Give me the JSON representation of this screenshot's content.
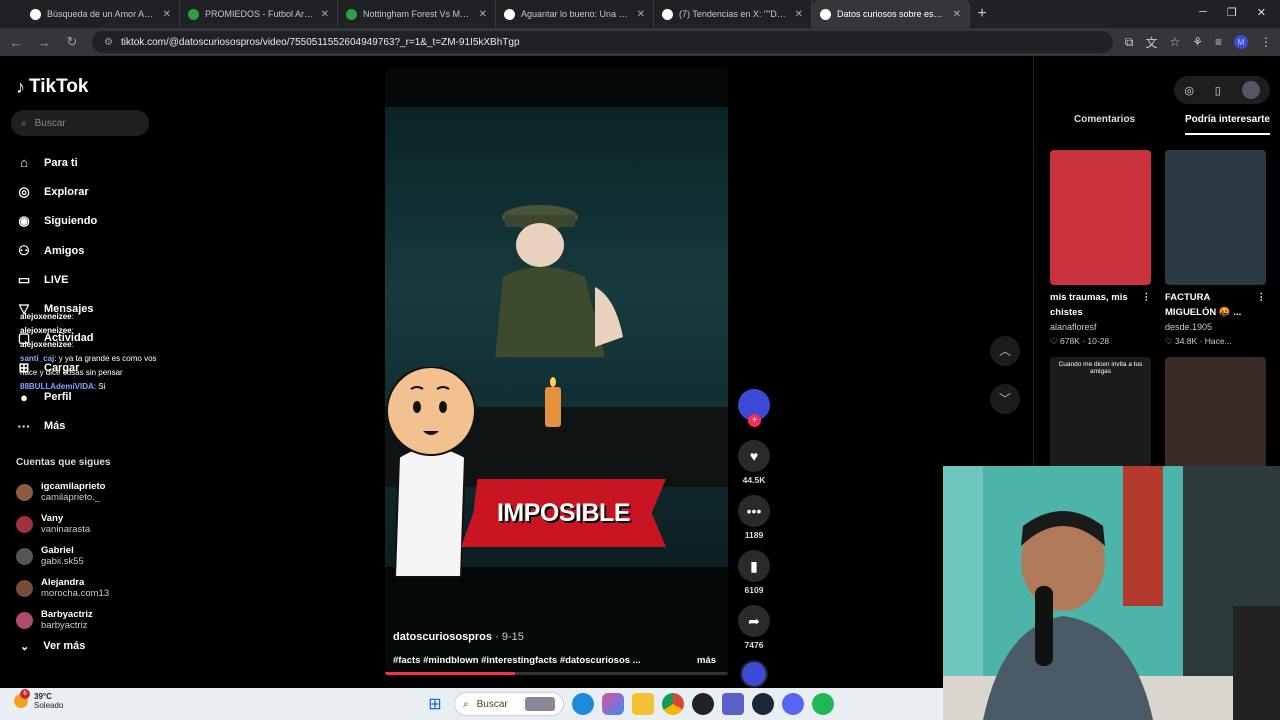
{
  "browser": {
    "tabs": [
      {
        "title": "Búsqueda de un Amor Apasionado",
        "color": "#ffffff"
      },
      {
        "title": "PROMIEDOS - Futbol Argentino",
        "color": "#2ea043"
      },
      {
        "title": "Nottingham Forest Vs Malmö FF",
        "color": "#2ea043"
      },
      {
        "title": "Aguantar lo bueno: Una experiencia",
        "color": "#ffffff"
      },
      {
        "title": "(7) Tendencias en X: \"\"Duka\": Pe",
        "color": "#ffffff"
      },
      {
        "title": "Datos curiosos sobre españoles",
        "color": "#ffffff",
        "active": true
      }
    ],
    "url": "tiktok.com/@datoscuriosospros/video/7550511552604949763?_r=1&_t=ZM-91I5kXBhTgp",
    "profile_initial": "M"
  },
  "sidebar": {
    "logo": "TikTok",
    "search_placeholder": "Buscar",
    "menu": [
      {
        "label": "Para ti",
        "icon": "home-icon",
        "glyph": "⌂"
      },
      {
        "label": "Explorar",
        "icon": "compass-icon",
        "glyph": "◎"
      },
      {
        "label": "Siguiendo",
        "icon": "following-icon",
        "glyph": "◉"
      },
      {
        "label": "Amigos",
        "icon": "friends-icon",
        "glyph": "⚇"
      },
      {
        "label": "LIVE",
        "icon": "live-icon",
        "glyph": "▭"
      },
      {
        "label": "Mensajes",
        "icon": "messages-icon",
        "glyph": "▽"
      },
      {
        "label": "Actividad",
        "icon": "activity-icon",
        "glyph": "▢"
      },
      {
        "label": "Cargar",
        "icon": "upload-icon",
        "glyph": "⊞"
      },
      {
        "label": "Perfil",
        "icon": "profile-icon",
        "glyph": "●"
      },
      {
        "label": "Más",
        "icon": "more-icon",
        "glyph": "···"
      }
    ],
    "chat": [
      {
        "user": "alejoxeneizee",
        "text": ":"
      },
      {
        "user": "alejoxeneizee",
        "text": ":"
      },
      {
        "user": "alejoxeneizee",
        "text": ":"
      },
      {
        "user": "santi_caj",
        "text": ": y ya ta grande es como vos hace y dice cosas sin pensar"
      },
      {
        "user": "88BULLAdemiVIDA",
        "text": ": Si"
      }
    ],
    "following_title": "Cuentas que sigues",
    "following": [
      {
        "name": "igcamilaprieto",
        "handle": "camilaprieto._",
        "color": "#8a5a44"
      },
      {
        "name": "Vany",
        "handle": "vaninarasta",
        "color": "#a03040"
      },
      {
        "name": "Gabriel",
        "handle": "gabii.sk55",
        "color": "#555555"
      },
      {
        "name": "Alejandra",
        "handle": "morocha.com13",
        "color": "#7a4a3a"
      },
      {
        "name": "Barbyactriz",
        "handle": "barbyactriz",
        "color": "#b04a6a"
      }
    ],
    "see_more": "Ver más"
  },
  "video": {
    "overlay_text": "IMPOSIBLE",
    "author": "datoscuriosospros",
    "date": "9-15",
    "description": "#facts #mindblown #interestingfacts #datoscuriosos ...",
    "more": "más",
    "progress_fraction": 0.38
  },
  "actions": {
    "likes": "44.5K",
    "comments": "1189",
    "saves": "6109",
    "shares": "7476"
  },
  "right_panel": {
    "tab_comments": "Comentarios",
    "tab_suggested": "Podría interesarte",
    "cards": [
      {
        "title": "mis traumas, mis chistes",
        "author": "alanafloresf",
        "likes": "678K",
        "date": "10-28",
        "color": "#c7323e"
      },
      {
        "title": "FACTURA MIGUELÓN 🤬 ...",
        "author": "desde.1905",
        "likes": "34.8K",
        "date": "Hace...",
        "color": "#2c3a44"
      },
      {
        "title": "",
        "author": "",
        "likes": "",
        "date": "",
        "color": "#1d1a1a",
        "caption": "Cuando me dicen invita a tus amigas"
      },
      {
        "title": "",
        "author": "",
        "likes": "",
        "date": "",
        "color": "#3a2a26"
      }
    ]
  },
  "taskbar": {
    "temp": "39°C",
    "condition": "Soleado",
    "notif_count": "6",
    "search": "Buscar"
  }
}
